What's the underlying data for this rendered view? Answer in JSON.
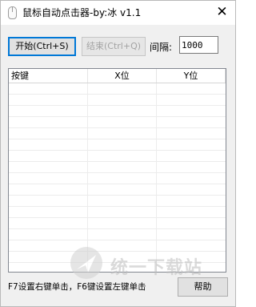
{
  "window": {
    "title": "鼠标自动点击器-by:冰 v1.1",
    "close_glyph": "✕"
  },
  "toolbar": {
    "start_label": "开始(Ctrl+S)",
    "stop_label": "结束(Ctrl+Q)",
    "interval_label": "间隔:",
    "interval_value": "1000"
  },
  "table": {
    "columns": [
      "按键",
      "X位",
      "Y位"
    ],
    "rows": []
  },
  "footer": {
    "hint": "F7设置右键单击，F6键设置左键单击",
    "help_label": "帮助"
  },
  "watermark": {
    "text": "统一下载站"
  },
  "colors": {
    "accent": "#0078d7",
    "window_bg": "#f0f0f0",
    "disabled_text": "#a3a3a3"
  },
  "icons": [
    "app-icon",
    "close-icon",
    "watermark-logo-icon"
  ]
}
